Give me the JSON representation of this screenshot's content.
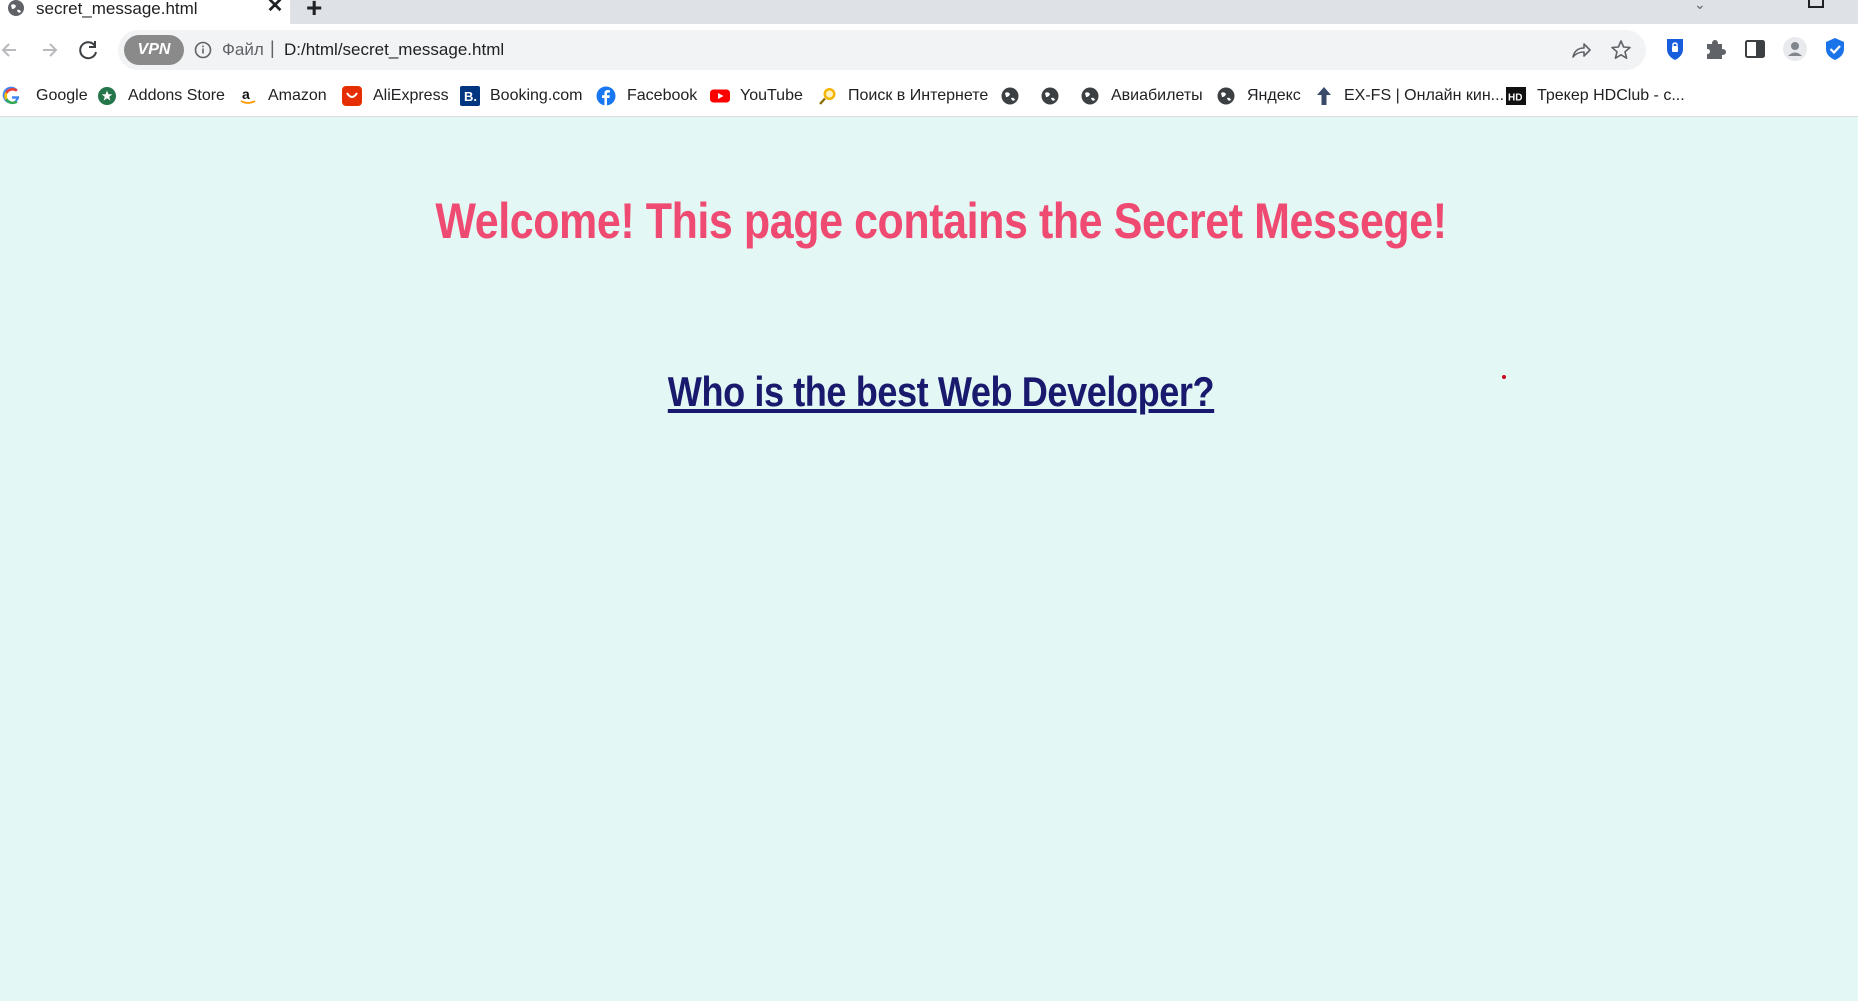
{
  "browser": {
    "tab": {
      "title": "secret_message.html",
      "close_glyph": "✕"
    },
    "new_tab_glyph": "+",
    "toolbar": {
      "vpn_label": "VPN",
      "scheme_label": "Файл",
      "url_separator": "|",
      "url": "D:/html/secret_message.html"
    },
    "bookmarks": [
      {
        "label": "Google",
        "icon": "google-icon"
      },
      {
        "label": "Addons Store",
        "icon": "addons-store-icon"
      },
      {
        "label": "Amazon",
        "icon": "amazon-icon"
      },
      {
        "label": "AliExpress",
        "icon": "aliexpress-icon"
      },
      {
        "label": "Booking.com",
        "icon": "booking-icon"
      },
      {
        "label": "Facebook",
        "icon": "facebook-icon"
      },
      {
        "label": "YouTube",
        "icon": "youtube-icon"
      },
      {
        "label": "Поиск в Интернете",
        "icon": "search-globe-icon"
      },
      {
        "label": "",
        "icon": "globe-icon"
      },
      {
        "label": "",
        "icon": "globe-icon"
      },
      {
        "label": "Авиабилеты",
        "icon": "globe-icon"
      },
      {
        "label": "Яндекс",
        "icon": "globe-icon"
      },
      {
        "label": "EX-FS | Онлайн кин...",
        "icon": "arrow-up-icon"
      },
      {
        "label": "Трекер HDClub - с...",
        "icon": "hd-icon"
      }
    ]
  },
  "page": {
    "heading": "Welcome! This page contains the Secret Messege!",
    "link_text": "Who is the best Web Developer?",
    "colors": {
      "background": "#e3f8f4",
      "heading": "#ef4a72",
      "link": "#191a6e"
    }
  }
}
